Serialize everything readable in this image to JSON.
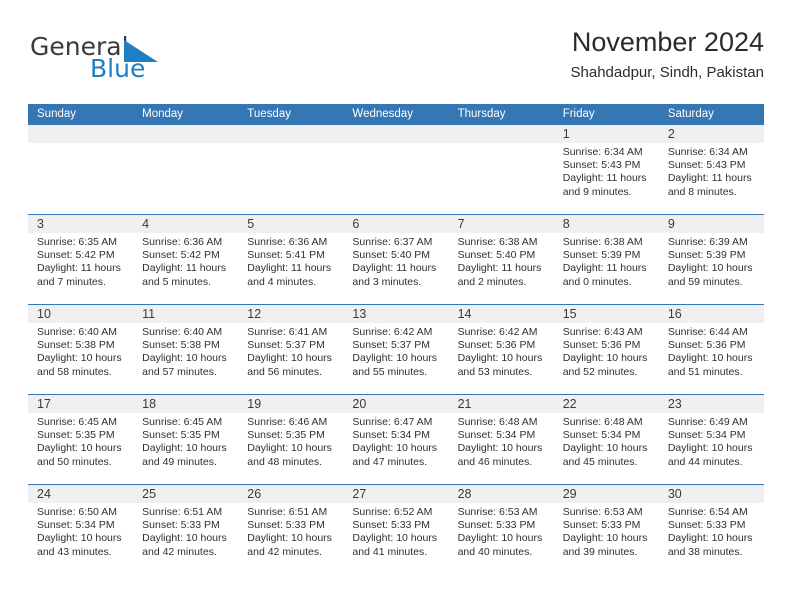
{
  "brand": {
    "name_top": "General",
    "name_bottom": "Blue",
    "accent_color": "#1f7fc4",
    "flag_icon": "triangle-flag-icon"
  },
  "header": {
    "title": "November 2024",
    "location": "Shahdadpur, Sindh, Pakistan"
  },
  "theme": {
    "header_blue": "#3576b5",
    "number_strip_gray": "#f0f0f0",
    "cell_white": "#ffffff"
  },
  "weekdays": [
    "Sunday",
    "Monday",
    "Tuesday",
    "Wednesday",
    "Thursday",
    "Friday",
    "Saturday"
  ],
  "weeks": [
    {
      "days": [
        {
          "num": "",
          "sunrise": "",
          "sunset": "",
          "daylight_1": "",
          "daylight_2": ""
        },
        {
          "num": "",
          "sunrise": "",
          "sunset": "",
          "daylight_1": "",
          "daylight_2": ""
        },
        {
          "num": "",
          "sunrise": "",
          "sunset": "",
          "daylight_1": "",
          "daylight_2": ""
        },
        {
          "num": "",
          "sunrise": "",
          "sunset": "",
          "daylight_1": "",
          "daylight_2": ""
        },
        {
          "num": "",
          "sunrise": "",
          "sunset": "",
          "daylight_1": "",
          "daylight_2": ""
        },
        {
          "num": "1",
          "sunrise": "Sunrise: 6:34 AM",
          "sunset": "Sunset: 5:43 PM",
          "daylight_1": "Daylight: 11 hours",
          "daylight_2": "and 9 minutes."
        },
        {
          "num": "2",
          "sunrise": "Sunrise: 6:34 AM",
          "sunset": "Sunset: 5:43 PM",
          "daylight_1": "Daylight: 11 hours",
          "daylight_2": "and 8 minutes."
        }
      ]
    },
    {
      "days": [
        {
          "num": "3",
          "sunrise": "Sunrise: 6:35 AM",
          "sunset": "Sunset: 5:42 PM",
          "daylight_1": "Daylight: 11 hours",
          "daylight_2": "and 7 minutes."
        },
        {
          "num": "4",
          "sunrise": "Sunrise: 6:36 AM",
          "sunset": "Sunset: 5:42 PM",
          "daylight_1": "Daylight: 11 hours",
          "daylight_2": "and 5 minutes."
        },
        {
          "num": "5",
          "sunrise": "Sunrise: 6:36 AM",
          "sunset": "Sunset: 5:41 PM",
          "daylight_1": "Daylight: 11 hours",
          "daylight_2": "and 4 minutes."
        },
        {
          "num": "6",
          "sunrise": "Sunrise: 6:37 AM",
          "sunset": "Sunset: 5:40 PM",
          "daylight_1": "Daylight: 11 hours",
          "daylight_2": "and 3 minutes."
        },
        {
          "num": "7",
          "sunrise": "Sunrise: 6:38 AM",
          "sunset": "Sunset: 5:40 PM",
          "daylight_1": "Daylight: 11 hours",
          "daylight_2": "and 2 minutes."
        },
        {
          "num": "8",
          "sunrise": "Sunrise: 6:38 AM",
          "sunset": "Sunset: 5:39 PM",
          "daylight_1": "Daylight: 11 hours",
          "daylight_2": "and 0 minutes."
        },
        {
          "num": "9",
          "sunrise": "Sunrise: 6:39 AM",
          "sunset": "Sunset: 5:39 PM",
          "daylight_1": "Daylight: 10 hours",
          "daylight_2": "and 59 minutes."
        }
      ]
    },
    {
      "days": [
        {
          "num": "10",
          "sunrise": "Sunrise: 6:40 AM",
          "sunset": "Sunset: 5:38 PM",
          "daylight_1": "Daylight: 10 hours",
          "daylight_2": "and 58 minutes."
        },
        {
          "num": "11",
          "sunrise": "Sunrise: 6:40 AM",
          "sunset": "Sunset: 5:38 PM",
          "daylight_1": "Daylight: 10 hours",
          "daylight_2": "and 57 minutes."
        },
        {
          "num": "12",
          "sunrise": "Sunrise: 6:41 AM",
          "sunset": "Sunset: 5:37 PM",
          "daylight_1": "Daylight: 10 hours",
          "daylight_2": "and 56 minutes."
        },
        {
          "num": "13",
          "sunrise": "Sunrise: 6:42 AM",
          "sunset": "Sunset: 5:37 PM",
          "daylight_1": "Daylight: 10 hours",
          "daylight_2": "and 55 minutes."
        },
        {
          "num": "14",
          "sunrise": "Sunrise: 6:42 AM",
          "sunset": "Sunset: 5:36 PM",
          "daylight_1": "Daylight: 10 hours",
          "daylight_2": "and 53 minutes."
        },
        {
          "num": "15",
          "sunrise": "Sunrise: 6:43 AM",
          "sunset": "Sunset: 5:36 PM",
          "daylight_1": "Daylight: 10 hours",
          "daylight_2": "and 52 minutes."
        },
        {
          "num": "16",
          "sunrise": "Sunrise: 6:44 AM",
          "sunset": "Sunset: 5:36 PM",
          "daylight_1": "Daylight: 10 hours",
          "daylight_2": "and 51 minutes."
        }
      ]
    },
    {
      "days": [
        {
          "num": "17",
          "sunrise": "Sunrise: 6:45 AM",
          "sunset": "Sunset: 5:35 PM",
          "daylight_1": "Daylight: 10 hours",
          "daylight_2": "and 50 minutes."
        },
        {
          "num": "18",
          "sunrise": "Sunrise: 6:45 AM",
          "sunset": "Sunset: 5:35 PM",
          "daylight_1": "Daylight: 10 hours",
          "daylight_2": "and 49 minutes."
        },
        {
          "num": "19",
          "sunrise": "Sunrise: 6:46 AM",
          "sunset": "Sunset: 5:35 PM",
          "daylight_1": "Daylight: 10 hours",
          "daylight_2": "and 48 minutes."
        },
        {
          "num": "20",
          "sunrise": "Sunrise: 6:47 AM",
          "sunset": "Sunset: 5:34 PM",
          "daylight_1": "Daylight: 10 hours",
          "daylight_2": "and 47 minutes."
        },
        {
          "num": "21",
          "sunrise": "Sunrise: 6:48 AM",
          "sunset": "Sunset: 5:34 PM",
          "daylight_1": "Daylight: 10 hours",
          "daylight_2": "and 46 minutes."
        },
        {
          "num": "22",
          "sunrise": "Sunrise: 6:48 AM",
          "sunset": "Sunset: 5:34 PM",
          "daylight_1": "Daylight: 10 hours",
          "daylight_2": "and 45 minutes."
        },
        {
          "num": "23",
          "sunrise": "Sunrise: 6:49 AM",
          "sunset": "Sunset: 5:34 PM",
          "daylight_1": "Daylight: 10 hours",
          "daylight_2": "and 44 minutes."
        }
      ]
    },
    {
      "days": [
        {
          "num": "24",
          "sunrise": "Sunrise: 6:50 AM",
          "sunset": "Sunset: 5:34 PM",
          "daylight_1": "Daylight: 10 hours",
          "daylight_2": "and 43 minutes."
        },
        {
          "num": "25",
          "sunrise": "Sunrise: 6:51 AM",
          "sunset": "Sunset: 5:33 PM",
          "daylight_1": "Daylight: 10 hours",
          "daylight_2": "and 42 minutes."
        },
        {
          "num": "26",
          "sunrise": "Sunrise: 6:51 AM",
          "sunset": "Sunset: 5:33 PM",
          "daylight_1": "Daylight: 10 hours",
          "daylight_2": "and 42 minutes."
        },
        {
          "num": "27",
          "sunrise": "Sunrise: 6:52 AM",
          "sunset": "Sunset: 5:33 PM",
          "daylight_1": "Daylight: 10 hours",
          "daylight_2": "and 41 minutes."
        },
        {
          "num": "28",
          "sunrise": "Sunrise: 6:53 AM",
          "sunset": "Sunset: 5:33 PM",
          "daylight_1": "Daylight: 10 hours",
          "daylight_2": "and 40 minutes."
        },
        {
          "num": "29",
          "sunrise": "Sunrise: 6:53 AM",
          "sunset": "Sunset: 5:33 PM",
          "daylight_1": "Daylight: 10 hours",
          "daylight_2": "and 39 minutes."
        },
        {
          "num": "30",
          "sunrise": "Sunrise: 6:54 AM",
          "sunset": "Sunset: 5:33 PM",
          "daylight_1": "Daylight: 10 hours",
          "daylight_2": "and 38 minutes."
        }
      ]
    }
  ]
}
